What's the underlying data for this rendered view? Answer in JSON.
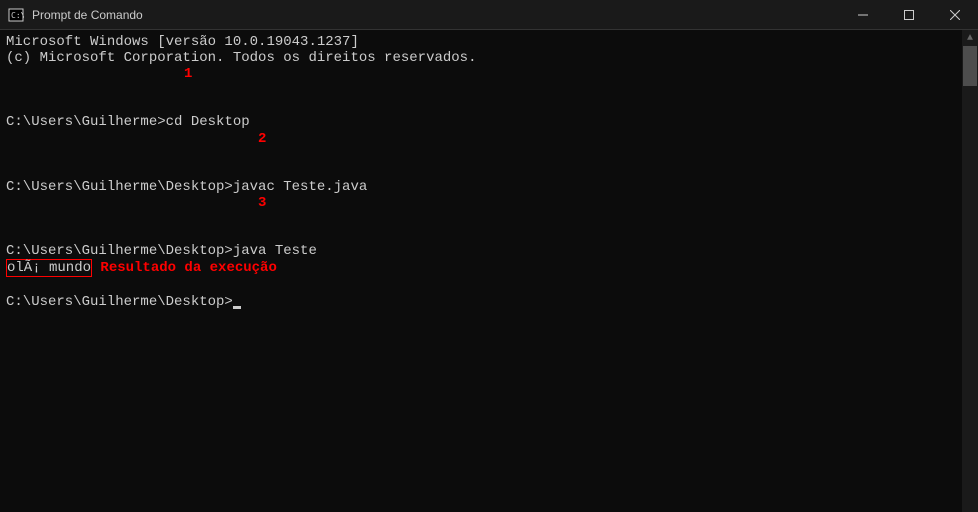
{
  "window": {
    "title": "Prompt de Comando"
  },
  "terminal": {
    "header1": "Microsoft Windows [versão 10.0.19043.1237]",
    "header2": "(c) Microsoft Corporation. Todos os direitos reservados.",
    "prompt1": "C:\\Users\\Guilherme>",
    "cmd1": "cd Desktop",
    "prompt2": "C:\\Users\\Guilherme\\Desktop>",
    "cmd2": "javac Teste.java",
    "prompt3": "C:\\Users\\Guilherme\\Desktop>",
    "cmd3": "java Teste",
    "output": "olÃ¡ mundo",
    "prompt4": "C:\\Users\\Guilherme\\Desktop>"
  },
  "annotations": {
    "num1": "1",
    "num2": "2",
    "num3": "3",
    "result_label": "Resultado da execução"
  }
}
